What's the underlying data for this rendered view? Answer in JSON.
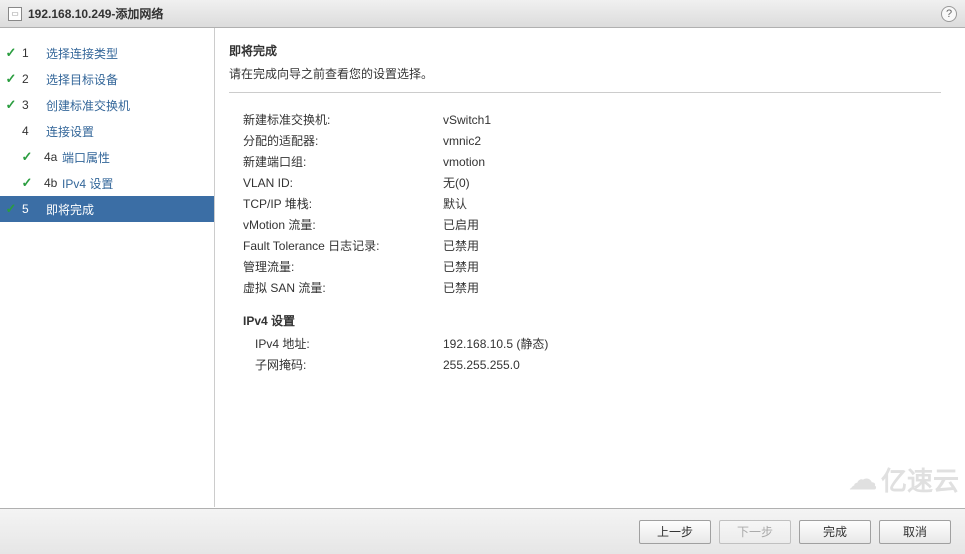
{
  "titlebar": {
    "ip": "192.168.10.249",
    "sep": " - ",
    "title": "添加网络"
  },
  "help": "?",
  "sidebar": {
    "steps": [
      {
        "num": "1",
        "label": "选择连接类型",
        "check": true
      },
      {
        "num": "2",
        "label": "选择目标设备",
        "check": true
      },
      {
        "num": "3",
        "label": "创建标准交换机",
        "check": true
      },
      {
        "num": "4",
        "label": "连接设置",
        "check": false
      },
      {
        "num": "4a",
        "label": "端口属性",
        "check": true,
        "sub": true
      },
      {
        "num": "4b",
        "label": "IPv4 设置",
        "check": true,
        "sub": true
      },
      {
        "num": "5",
        "label": "即将完成",
        "check": true,
        "active": true
      }
    ]
  },
  "main": {
    "title": "即将完成",
    "subtitle": "请在完成向导之前查看您的设置选择。",
    "rows": [
      {
        "label": "新建标准交换机:",
        "value": "vSwitch1"
      },
      {
        "label": "分配的适配器:",
        "value": "vmnic2"
      },
      {
        "label": "新建端口组:",
        "value": "vmotion"
      },
      {
        "label": "VLAN ID:",
        "value": "无(0)"
      },
      {
        "label": "TCP/IP 堆栈:",
        "value": "默认"
      },
      {
        "label": "vMotion 流量:",
        "value": "已启用"
      },
      {
        "label": "Fault Tolerance 日志记录:",
        "value": "已禁用"
      },
      {
        "label": "管理流量:",
        "value": "已禁用"
      },
      {
        "label": "虚拟 SAN 流量:",
        "value": "已禁用"
      }
    ],
    "ipv4_section": "IPv4 设置",
    "ipv4_rows": [
      {
        "label": "IPv4 地址:",
        "value": "192.168.10.5 (静态)"
      },
      {
        "label": "子网掩码:",
        "value": "255.255.255.0"
      }
    ]
  },
  "footer": {
    "back": "上一步",
    "next": "下一步",
    "finish": "完成",
    "cancel": "取消"
  },
  "watermark": "亿速云"
}
